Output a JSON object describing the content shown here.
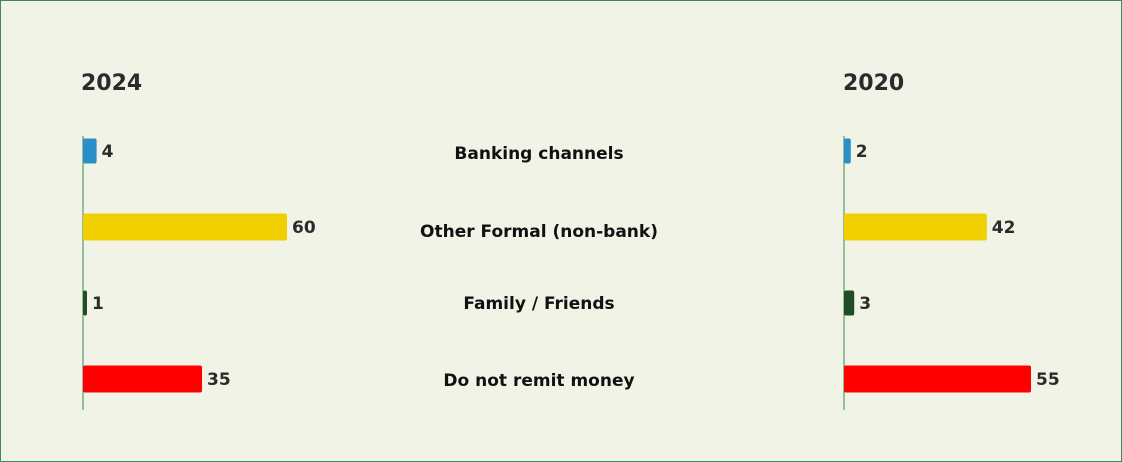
{
  "chart_data": {
    "type": "bar",
    "orientation": "horizontal",
    "categories": [
      "Banking channels",
      "Other Formal (non-bank)",
      "Family / Friends",
      "Do not remit money"
    ],
    "colors": [
      "#2a8fc7",
      "#f2cf00",
      "#1f4d25",
      "#ff0000"
    ],
    "axis_color": "#3c8a55",
    "panels": [
      {
        "title": "2024",
        "values": [
          4,
          60,
          1,
          35
        ]
      },
      {
        "title": "2020",
        "values": [
          2,
          42,
          3,
          55
        ]
      }
    ]
  }
}
